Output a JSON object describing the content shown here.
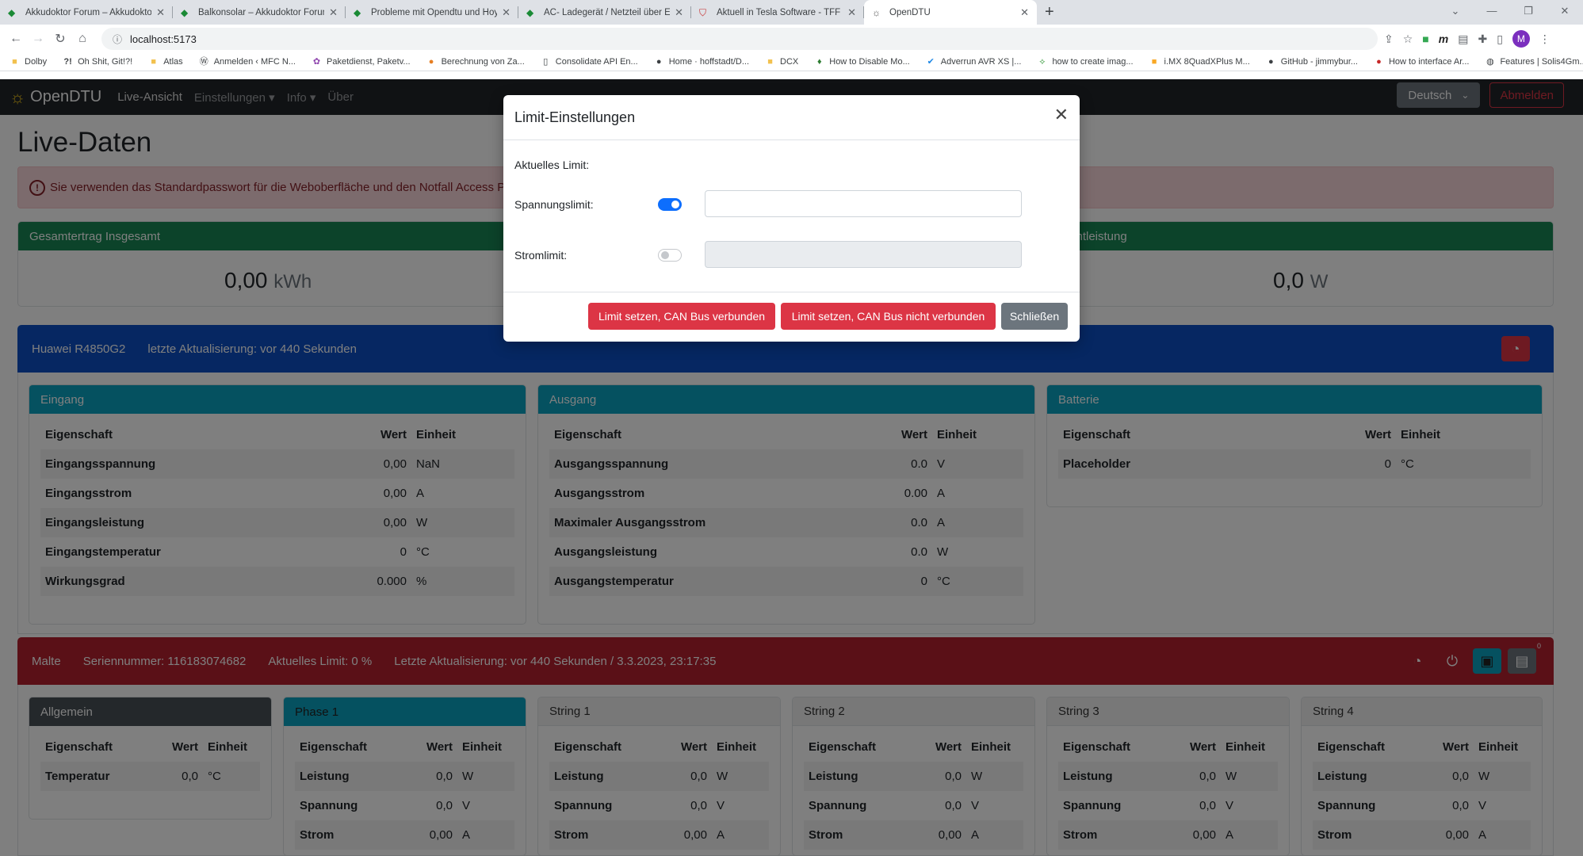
{
  "browser": {
    "tabs": [
      {
        "title": "Akkudoktor Forum – Akkudoktor"
      },
      {
        "title": "Balkonsolar – Akkudoktor Forum"
      },
      {
        "title": "Probleme mit Opendtu und Hoy"
      },
      {
        "title": "AC- Ladegerät / Netzteil über ESI"
      },
      {
        "title": "Aktuell in Tesla Software - TFF Fo"
      },
      {
        "title": "OpenDTU"
      }
    ],
    "url": "localhost:5173",
    "avatar_letter": "M",
    "bookmarks": [
      "Dolby",
      "Oh Shit, Git!?!",
      "Atlas",
      "Anmelden ‹ MFC N...",
      "Paketdienst, Paketv...",
      "Berechnung von Za...",
      "Consolidate API En...",
      "Home · hoffstadt/D...",
      "DCX",
      "How to Disable Mo...",
      "Adverrun AVR XS |...",
      "how to create imag...",
      "i.MX 8QuadXPlus M...",
      "GitHub - jimmybur...",
      "How to interface Ar...",
      "Features | Solis4Gm..."
    ]
  },
  "nav": {
    "brand": "OpenDTU",
    "live": "Live-Ansicht",
    "settings": "Einstellungen",
    "info": "Info",
    "about": "Über",
    "language": "Deutsch",
    "logout": "Abmelden"
  },
  "page": {
    "title": "Live-Daten",
    "alert": "Sie verwenden das Standardpasswort für die Weboberfläche und den Notfall Access Point"
  },
  "summary": {
    "total_header": "Gesamtertrag Insgesamt",
    "total_value": "0,00",
    "total_unit": "kWh",
    "power_header": "amtleistung",
    "power_value": "0,0",
    "power_unit": "W"
  },
  "charger": {
    "name": "Huawei R4850G2",
    "update": "letzte Aktualisierung: vor 440 Sekunden",
    "header_color": "#0d4fc4",
    "cols": {
      "prop": "Eigenschaft",
      "val": "Wert",
      "unit": "Einheit"
    },
    "input": {
      "title": "Eingang",
      "rows": [
        {
          "p": "Eingangsspannung",
          "v": "0,00",
          "u": "NaN"
        },
        {
          "p": "Eingangsstrom",
          "v": "0,00",
          "u": "A"
        },
        {
          "p": "Eingangsleistung",
          "v": "0,00",
          "u": "W"
        },
        {
          "p": "Eingangstemperatur",
          "v": "0",
          "u": "°C"
        },
        {
          "p": "Wirkungsgrad",
          "v": "0.000",
          "u": "%"
        }
      ]
    },
    "output": {
      "title": "Ausgang",
      "rows": [
        {
          "p": "Ausgangsspannung",
          "v": "0.0",
          "u": "V"
        },
        {
          "p": "Ausgangsstrom",
          "v": "0.00",
          "u": "A"
        },
        {
          "p": "Maximaler Ausgangsstrom",
          "v": "0.0",
          "u": "A"
        },
        {
          "p": "Ausgangsleistung",
          "v": "0.0",
          "u": "W"
        },
        {
          "p": "Ausgangstemperatur",
          "v": "0",
          "u": "°C"
        }
      ]
    },
    "battery": {
      "title": "Batterie",
      "rows": [
        {
          "p": "Placeholder",
          "v": "0",
          "u": "°C"
        }
      ]
    }
  },
  "inverter": {
    "name": "Malte",
    "serial": "Seriennummer: 116183074682",
    "limit": "Aktuelles Limit: 0 %",
    "update": "Letzte Aktualisierung: vor 440 Sekunden / 3.3.2023, 23:17:35",
    "badge": "0",
    "header_color": "#b4202e",
    "cols": {
      "prop": "Eigenschaft",
      "val": "Wert",
      "unit": "Einheit"
    },
    "general": {
      "title": "Allgemein",
      "rows": [
        {
          "p": "Temperatur",
          "v": "0,0",
          "u": "°C"
        }
      ]
    },
    "phase1": {
      "title": "Phase 1",
      "rows": [
        {
          "p": "Leistung",
          "v": "0,0",
          "u": "W"
        },
        {
          "p": "Spannung",
          "v": "0,0",
          "u": "V"
        },
        {
          "p": "Strom",
          "v": "0,00",
          "u": "A"
        }
      ]
    },
    "string1": {
      "title": "String 1",
      "rows": [
        {
          "p": "Leistung",
          "v": "0,0",
          "u": "W"
        },
        {
          "p": "Spannung",
          "v": "0,0",
          "u": "V"
        },
        {
          "p": "Strom",
          "v": "0,00",
          "u": "A"
        }
      ]
    },
    "string2": {
      "title": "String 2",
      "rows": [
        {
          "p": "Leistung",
          "v": "0,0",
          "u": "W"
        },
        {
          "p": "Spannung",
          "v": "0,0",
          "u": "V"
        },
        {
          "p": "Strom",
          "v": "0,00",
          "u": "A"
        }
      ]
    },
    "string3": {
      "title": "String 3",
      "rows": [
        {
          "p": "Leistung",
          "v": "0,0",
          "u": "W"
        },
        {
          "p": "Spannung",
          "v": "0,0",
          "u": "V"
        },
        {
          "p": "Strom",
          "v": "0,00",
          "u": "A"
        }
      ]
    },
    "string4": {
      "title": "String 4",
      "rows": [
        {
          "p": "Leistung",
          "v": "0,0",
          "u": "W"
        },
        {
          "p": "Spannung",
          "v": "0,0",
          "u": "V"
        },
        {
          "p": "Strom",
          "v": "0,00",
          "u": "A"
        }
      ]
    }
  },
  "modal": {
    "title": "Limit-Einstellungen",
    "current_limit": "Aktuelles Limit:",
    "voltage_label": "Spannungslimit:",
    "voltage_enabled": true,
    "voltage_value": "",
    "current_label": "Stromlimit:",
    "current_enabled": false,
    "current_value": "",
    "btn_connected": "Limit setzen, CAN Bus verbunden",
    "btn_disconnected": "Limit setzen, CAN Bus nicht verbunden",
    "btn_close": "Schließen"
  }
}
